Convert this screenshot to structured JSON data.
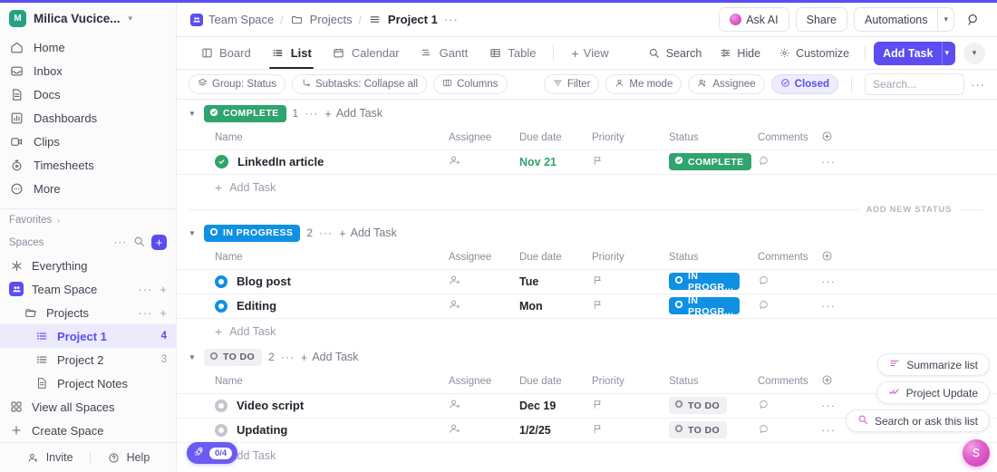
{
  "theme": {
    "accent": "#5b4df0",
    "green": "#30a46c",
    "blue": "#1090e3",
    "grey": "#c3c6cd",
    "pink": "#e060cb"
  },
  "sidebar": {
    "workspace": {
      "initial": "M",
      "name": "Milica Vucice...",
      "caret": "⌄"
    },
    "nav": [
      {
        "label": "Home",
        "icon": "home-icon"
      },
      {
        "label": "Inbox",
        "icon": "inbox-icon"
      },
      {
        "label": "Docs",
        "icon": "docs-icon"
      },
      {
        "label": "Dashboards",
        "icon": "dashboards-icon"
      },
      {
        "label": "Clips",
        "icon": "clips-icon"
      },
      {
        "label": "Timesheets",
        "icon": "timesheets-icon"
      },
      {
        "label": "More",
        "icon": "more-icon"
      }
    ],
    "favorites": {
      "label": "Favorites",
      "chevron": "›"
    },
    "spaces": {
      "label": "Spaces",
      "dots": "···",
      "plus": "+"
    },
    "tree": [
      {
        "label": "Everything",
        "icon": "everything-icon",
        "indent": 0,
        "count": "",
        "trailing": ""
      },
      {
        "label": "Team Space",
        "icon": "team-space-icon",
        "indent": 0,
        "count": "",
        "trailing": "··· +"
      },
      {
        "label": "Projects",
        "icon": "folder-icon",
        "indent": 1,
        "count": "",
        "trailing": "··· +"
      },
      {
        "label": "Project 1",
        "icon": "list-icon",
        "indent": 2,
        "count": "4",
        "active": true
      },
      {
        "label": "Project 2",
        "icon": "list-icon",
        "indent": 2,
        "count": "3"
      },
      {
        "label": "Project Notes",
        "icon": "doc-icon",
        "indent": 2,
        "count": ""
      },
      {
        "label": "View all Spaces",
        "icon": "grid-icon",
        "indent": 0,
        "count": ""
      },
      {
        "label": "Create Space",
        "icon": "plus-icon",
        "indent": 0,
        "count": ""
      }
    ],
    "footer": {
      "invite": "Invite",
      "help": "Help"
    }
  },
  "topbar": {
    "breadcrumb": [
      {
        "label": "Team Space",
        "icon": "team-space-icon"
      },
      {
        "label": "Projects",
        "icon": "folder-icon"
      },
      {
        "label": "Project 1",
        "icon": "list-icon",
        "current": true
      }
    ],
    "separator": "/",
    "dots": "···",
    "ask_ai": "Ask AI",
    "share": "Share",
    "automations": "Automations",
    "automations_caret": "⌄",
    "search_icon": "search-icon"
  },
  "viewbar": {
    "tabs": [
      {
        "label": "Board",
        "icon": "board-icon",
        "active": false
      },
      {
        "label": "List",
        "icon": "list-view-icon",
        "active": true
      },
      {
        "label": "Calendar",
        "icon": "calendar-icon",
        "active": false
      },
      {
        "label": "Gantt",
        "icon": "gantt-icon",
        "active": false
      },
      {
        "label": "Table",
        "icon": "table-icon",
        "active": false
      }
    ],
    "add_view": "+ View",
    "add_view_label": "View",
    "search": "Search",
    "hide": "Hide",
    "customize": "Customize",
    "add_task": "Add Task",
    "add_task_caret": "⌄",
    "more_caret": "⌄"
  },
  "filterbar": {
    "group": "Group: Status",
    "subtasks": "Subtasks: Collapse all",
    "columns": "Columns",
    "filter": "Filter",
    "me_mode": "Me mode",
    "assignee": "Assignee",
    "closed": "Closed",
    "search_placeholder": "Search...",
    "dots": "···"
  },
  "columns": [
    "Name",
    "Assignee",
    "Due date",
    "Priority",
    "Status",
    "Comments"
  ],
  "add_column_icon": "add-column-icon",
  "add_task_label": "Add Task",
  "add_new_status": "ADD NEW STATUS",
  "groups": [
    {
      "status": "COMPLETE",
      "color": "#30a46c",
      "kind": "complete",
      "count": "1",
      "tasks": [
        {
          "name": "LinkedIn article",
          "assignee": "",
          "due": "Nov 21",
          "due_color": "green",
          "priority": "",
          "status": "COMPLETE",
          "status_short": "COMPLETE",
          "comments": ""
        }
      ]
    },
    {
      "status": "IN PROGRESS",
      "color": "#1090e3",
      "kind": "progress",
      "count": "2",
      "tasks": [
        {
          "name": "Blog post",
          "assignee": "",
          "due": "Tue",
          "due_color": "dark",
          "priority": "",
          "status": "IN PROGRESS",
          "status_short": "IN PROGR...",
          "comments": ""
        },
        {
          "name": "Editing",
          "assignee": "",
          "due": "Mon",
          "due_color": "dark",
          "priority": "",
          "status": "IN PROGRESS",
          "status_short": "IN PROGR...",
          "comments": ""
        }
      ]
    },
    {
      "status": "TO DO",
      "color": "#c3c6cd",
      "kind": "todo",
      "count": "2",
      "tasks": [
        {
          "name": "Video script",
          "assignee": "",
          "due": "Dec 19",
          "due_color": "dark",
          "priority": "",
          "status": "TO DO",
          "status_short": "TO DO",
          "comments": ""
        },
        {
          "name": "Updating",
          "assignee": "",
          "due": "1/2/25",
          "due_color": "dark",
          "priority": "",
          "status": "TO DO",
          "status_short": "TO DO",
          "comments": ""
        }
      ]
    }
  ],
  "ai_panel": {
    "summarize": "Summarize list",
    "project_update": "Project Update",
    "search_ask": "Search or ask this list",
    "fab_icon": "clickup-ai-icon"
  },
  "rocket": {
    "progress": "0/4",
    "icon": "rocket-icon"
  }
}
